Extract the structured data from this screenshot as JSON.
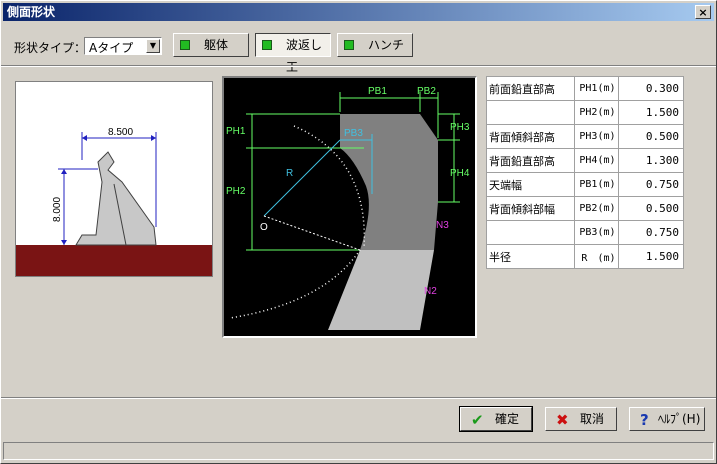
{
  "window": {
    "title": "側面形状",
    "close_glyph": "×"
  },
  "toolbar": {
    "shape_type_label": "形状タイプ：",
    "shape_type_value": "Aタイプ",
    "buttons": [
      {
        "label": "躯体",
        "active": false
      },
      {
        "label": "波返し工",
        "active": true
      },
      {
        "label": "ハンチ",
        "active": false
      }
    ]
  },
  "overview": {
    "dim_width": "8.500",
    "dim_height": "8.000"
  },
  "diagram": {
    "labels": {
      "pb1": "PB1",
      "pb2": "PB2",
      "pb3": "PB3",
      "ph1": "PH1",
      "ph2": "PH2",
      "ph3": "PH3",
      "ph4": "PH4",
      "r": "R",
      "o": "O",
      "n2": "N2",
      "n3": "N3"
    }
  },
  "params": [
    {
      "name": "前面鉛直部高",
      "unit": "PH1(m)",
      "value": "0.300"
    },
    {
      "name": "",
      "unit": "PH2(m)",
      "value": "1.500"
    },
    {
      "name": "背面傾斜部高",
      "unit": "PH3(m)",
      "value": "0.500"
    },
    {
      "name": "背面鉛直部高",
      "unit": "PH4(m)",
      "value": "1.300"
    },
    {
      "name": "天端幅",
      "unit": "PB1(m)",
      "value": "0.750"
    },
    {
      "name": "背面傾斜部幅",
      "unit": "PB2(m)",
      "value": "0.500"
    },
    {
      "name": "",
      "unit": "PB3(m)",
      "value": "0.750"
    },
    {
      "name": "半径",
      "unit": "R　(m)",
      "value": "1.500"
    }
  ],
  "footer": {
    "ok_label": "確定",
    "cancel_label": "取消",
    "help_label": "ﾍﾙﾌﾟ(H)"
  },
  "colors": {
    "accent_green": "#22bb22",
    "ground": "#7a1414",
    "diagram_bg": "#000000"
  }
}
